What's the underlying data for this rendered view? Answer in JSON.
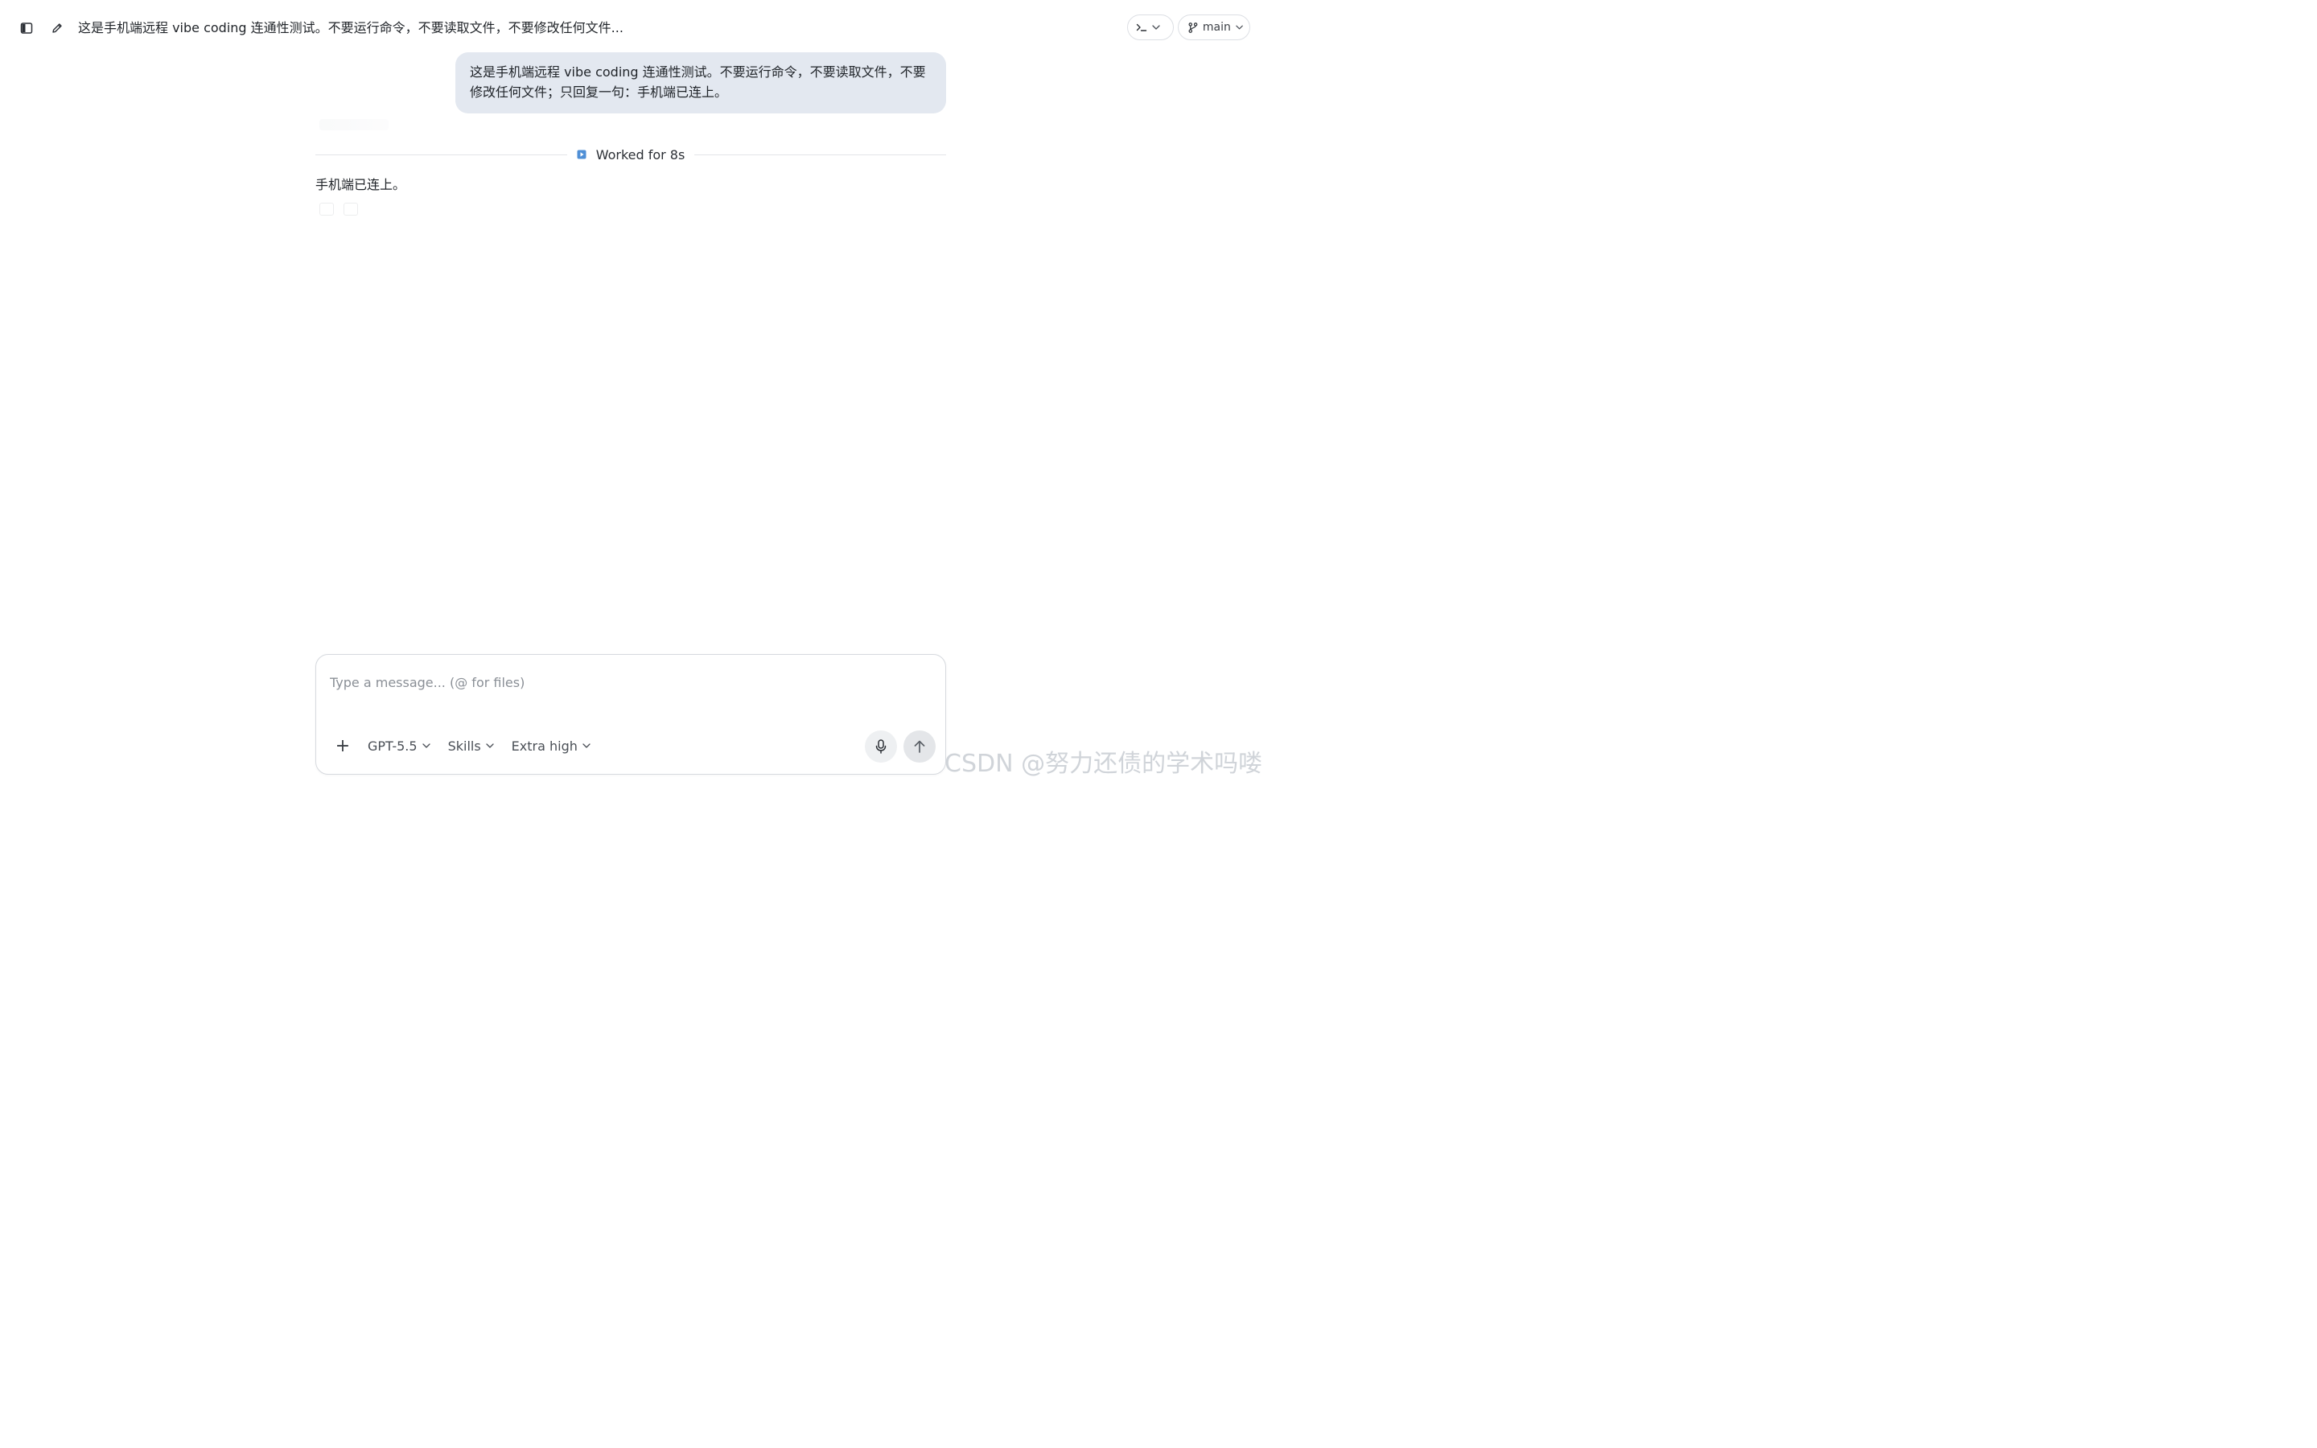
{
  "header": {
    "thread_title": "这是手机端远程 vibe coding 连通性测试。不要运行命令，不要读取文件，不要修改任何文件...",
    "branch_label": "main",
    "terminal_icon": "terminal-prompt-icon",
    "branch_icon": "git-branch-icon"
  },
  "conversation": {
    "user_message": "这是手机端远程 vibe coding 连通性测试。不要运行命令，不要读取文件，不要修改任何文件；只回复一句：手机端已连上。",
    "worked_label": "Worked for 8s",
    "assistant_message": "手机端已连上。"
  },
  "composer": {
    "placeholder": "Type a message... (@ for files)",
    "value": "",
    "add_label": "+",
    "model_label": "GPT-5.5",
    "skills_label": "Skills",
    "effort_label": "Extra high"
  },
  "watermark": "CSDN @努力还债的学术吗喽",
  "colors": {
    "user_bubble": "#e3e8f0",
    "accent_blue": "#3b82c4",
    "border": "#d6d9de"
  }
}
